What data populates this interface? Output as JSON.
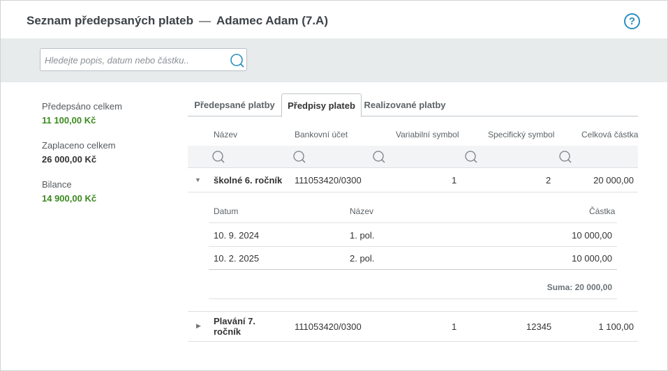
{
  "header": {
    "title": "Seznam předepsaných plateb",
    "separator": "—",
    "student": "Adamec Adam (7.A)",
    "help_label": "?"
  },
  "search": {
    "placeholder": "Hledejte popis, datum nebo částku.."
  },
  "summary": {
    "prescribed_label": "Předepsáno celkem",
    "prescribed_value": "11 100,00 Kč",
    "paid_label": "Zaplaceno celkem",
    "paid_value": "26 000,00 Kč",
    "balance_label": "Bilance",
    "balance_value": "14 900,00 Kč"
  },
  "tabs": [
    {
      "label": "Předepsané platby"
    },
    {
      "label": "Předpisy plateb"
    },
    {
      "label": "Realizované platby"
    }
  ],
  "table": {
    "columns": [
      "Název",
      "Bankovní účet",
      "Variabilní symbol",
      "Specifický symbol",
      "Celková částka"
    ],
    "rows": [
      {
        "name": "školné 6. ročník",
        "account": "111053420/0300",
        "variable_symbol": "1",
        "specific_symbol": "2",
        "total": "20 000,00",
        "expanded": true,
        "detail": {
          "columns": [
            "Datum",
            "Název",
            "Částka"
          ],
          "items": [
            {
              "date": "10. 9. 2024",
              "name": "1. pol.",
              "amount": "10 000,00"
            },
            {
              "date": "10. 2. 2025",
              "name": "2. pol.",
              "amount": "10 000,00"
            }
          ],
          "sum": "Suma: 20 000,00"
        }
      },
      {
        "name_line1": "Plavání 7.",
        "name_line2": "ročník",
        "account": "111053420/0300",
        "variable_symbol": "1",
        "specific_symbol": "12345",
        "total": "1 100,00",
        "expanded": false
      }
    ]
  },
  "colors": {
    "accent": "#2a8fbf",
    "positive": "#3b8a20",
    "toolbar_bg": "#e8ebec"
  }
}
